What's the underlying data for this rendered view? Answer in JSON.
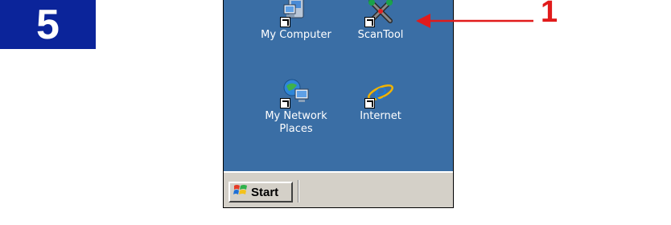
{
  "step": {
    "number": "5"
  },
  "desktop": {
    "icons": [
      {
        "id": "my-computer",
        "label": "My Computer",
        "icon": "computer-icon"
      },
      {
        "id": "scantool",
        "label": "ScanTool",
        "icon": "scantool-icon"
      },
      {
        "id": "my-network-places",
        "label": "My Network\nPlaces",
        "icon": "network-places-icon"
      },
      {
        "id": "internet",
        "label": "Internet",
        "icon": "internet-explorer-icon"
      }
    ],
    "background_color": "#3a6ea5"
  },
  "taskbar": {
    "start_label": "Start"
  },
  "callout": {
    "number": "1",
    "color": "#e11b1b"
  }
}
